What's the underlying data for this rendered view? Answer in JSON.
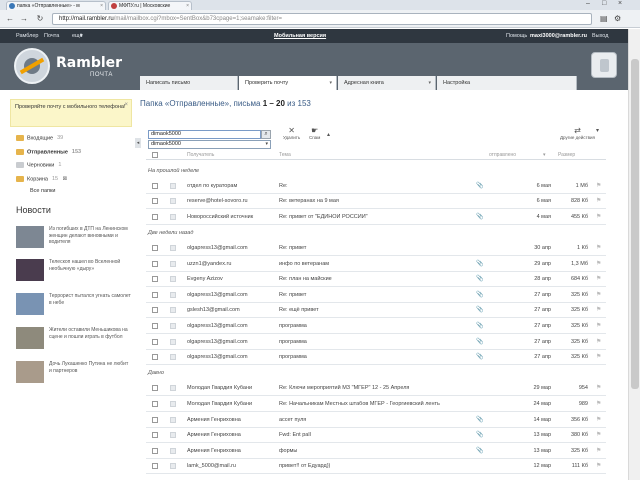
{
  "browser": {
    "tabs": [
      {
        "title": "папка «Отправленные» - м"
      },
      {
        "title": "МФПУ.ru | Московские"
      }
    ],
    "url_host": "http://mail.rambler.ru",
    "url_rest": "/mail/mailbox.cgi?mbox=SentBox&b73cpage=1;seamake:filter="
  },
  "topbar": {
    "brand": "Рамблер",
    "mail_link": "Почта",
    "more": "ещё",
    "mobile": "Мобильная версия",
    "settings": "Помощь",
    "user": "maxi3000@rambler.ru",
    "logout": "Выход"
  },
  "header": {
    "logo_text": "Rambler",
    "logo_sub": "ПОЧТА",
    "tabs": [
      {
        "label": "Написать письмо"
      },
      {
        "label": "Проверить почту"
      },
      {
        "label": "Адресная книга"
      },
      {
        "label": "Настройка"
      }
    ]
  },
  "sidebar": {
    "promo": "Проверяйте почту с мобильного телефона!",
    "folders": [
      {
        "label": "Входящие",
        "count": "39"
      },
      {
        "label": "Отправленные",
        "count": "153"
      },
      {
        "label": "Черновики",
        "count": "1"
      },
      {
        "label": "Корзина",
        "count": "15"
      }
    ],
    "all_folders": "Все папки",
    "news_title": "Новости",
    "news": [
      {
        "text": "Из погибших в ДТП на Ленинском женщин делают виновными и водителя"
      },
      {
        "text": "Телескоп нашел во Вселенной необычную «дыру»"
      },
      {
        "text": "Террорист пытался угнать самолет в небе"
      },
      {
        "text": "Жители оставили Меньшикова на сцене и пошли играть в футбол"
      },
      {
        "text": "Дочь Лукашенко Путина не любит и партнеров"
      }
    ]
  },
  "main": {
    "title_prefix": "Папка «Отправленные», письма ",
    "title_range": "1 – 20",
    "title_suffix": " из 153",
    "search_value": "dimaok5000",
    "search_suggestion": "dimaok5000",
    "tools": {
      "delete": "Удалить",
      "spam": "Спам",
      "other": "Другие действия"
    },
    "columns": {
      "from": "Получатель",
      "subject": "Тема",
      "sort": "отправлено",
      "size": "Размер"
    },
    "groups": {
      "this_week": "На прошлой неделе",
      "two_weeks": "Две недели назад",
      "older": "Давно"
    },
    "rows": [
      {
        "from": "отдел по кураторам",
        "subject": "Re:",
        "att": "📎",
        "date": "6 мая",
        "size": "1 Мб"
      },
      {
        "from": "reserve@hotel-sovoro.ru",
        "subject": "Re: ветеранах на 9 мая",
        "att": "",
        "date": "6 мая",
        "size": "828 Кб"
      },
      {
        "from": "Новороссийский источник",
        "subject": "Re: привет от \"ЕДИНОЙ РОССИИ\"",
        "att": "📎",
        "date": "4 мая",
        "size": "455 Кб"
      },
      {
        "from": "olgapress13@gmail.com",
        "subject": "Re: привет",
        "att": "",
        "date": "30 апр",
        "size": "1 Кб"
      },
      {
        "from": "uzzn1@yandex.ru",
        "subject": "инфо по ветеранам",
        "att": "📎",
        "date": "29 апр",
        "size": "1,3 Мб"
      },
      {
        "from": "Evgeny Azizov",
        "subject": "Re: план на майские",
        "att": "📎",
        "date": "28 апр",
        "size": "684 Кб"
      },
      {
        "from": "olgapress13@gmail.com",
        "subject": "Re: привет",
        "att": "📎",
        "date": "27 апр",
        "size": "325 Кб"
      },
      {
        "from": "gslesh13@gmail.com",
        "subject": "Re: ещё привет",
        "att": "📎",
        "date": "27 апр",
        "size": "325 Кб"
      },
      {
        "from": "olgapress13@gmail.com",
        "subject": "программа",
        "att": "📎",
        "date": "27 апр",
        "size": "325 Кб"
      },
      {
        "from": "olgapress13@gmail.com",
        "subject": "программа",
        "att": "📎",
        "date": "27 апр",
        "size": "325 Кб"
      },
      {
        "from": "olgapress13@gmail.com",
        "subject": "программа",
        "att": "📎",
        "date": "27 апр",
        "size": "325 Кб"
      },
      {
        "from": "Молодая Гвардия Кубани",
        "subject": "Re: Ключи мероприятий МЗ \"МГЕР\" 12 - 25 Апреля",
        "att": "",
        "date": "29 мар",
        "size": "954"
      },
      {
        "from": "Молодая Гвардия Кубани",
        "subject": "Re: Начальникам Местных штабов МГЕР - Георгиевский ленть",
        "att": "",
        "date": "24 мар",
        "size": "989"
      },
      {
        "from": "Армения Генриховна",
        "subject": "ассет пуля",
        "att": "📎",
        "date": "14 мар",
        "size": "356 Кб"
      },
      {
        "from": "Армения Генриховна",
        "subject": "Fwd: Ent pall",
        "att": "📎",
        "date": "13 мар",
        "size": "380 Кб"
      },
      {
        "from": "Армения Генриховна",
        "subject": "формы",
        "att": "📎",
        "date": "13 мар",
        "size": "325 Кб"
      },
      {
        "from": "lamk_5000@mail.ru",
        "subject": "привет!! от Едуард))",
        "att": "",
        "date": "12 мар",
        "size": "111 Кб"
      }
    ]
  }
}
